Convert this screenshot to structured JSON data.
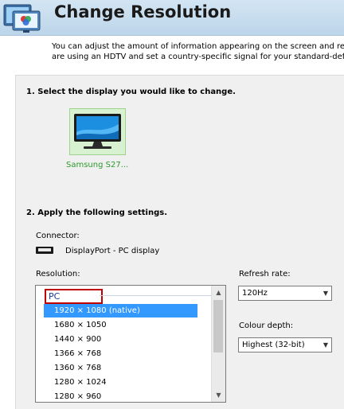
{
  "header": {
    "title": "Change Resolution",
    "icon": "display-settings-icon"
  },
  "description": {
    "line1": "You can adjust the amount of information appearing on the screen and reduce",
    "line2": "are using an HDTV and set a country-specific signal for your standard-definition"
  },
  "section1": {
    "title": "1. Select the display you would like to change."
  },
  "display": {
    "name": "Samsung S27...",
    "icon": "monitor-icon"
  },
  "section2": {
    "title": "2. Apply the following settings."
  },
  "connector": {
    "label": "Connector:",
    "value": "DisplayPort - PC display",
    "icon": "displayport-icon"
  },
  "resolution": {
    "label": "Resolution:",
    "group": "PC",
    "items": [
      "1920 × 1080 (native)",
      "1680 × 1050",
      "1440 × 900",
      "1366 × 768",
      "1360 × 768",
      "1280 × 1024",
      "1280 × 960"
    ],
    "selected_index": 0
  },
  "refresh_rate": {
    "label": "Refresh rate:",
    "value": "120Hz"
  },
  "colour_depth": {
    "label": "Colour depth:",
    "value": "Highest (32-bit)"
  },
  "colors": {
    "accent": "#3399ff",
    "highlight_border": "#c00000",
    "display_name": "#2c9a2c"
  }
}
